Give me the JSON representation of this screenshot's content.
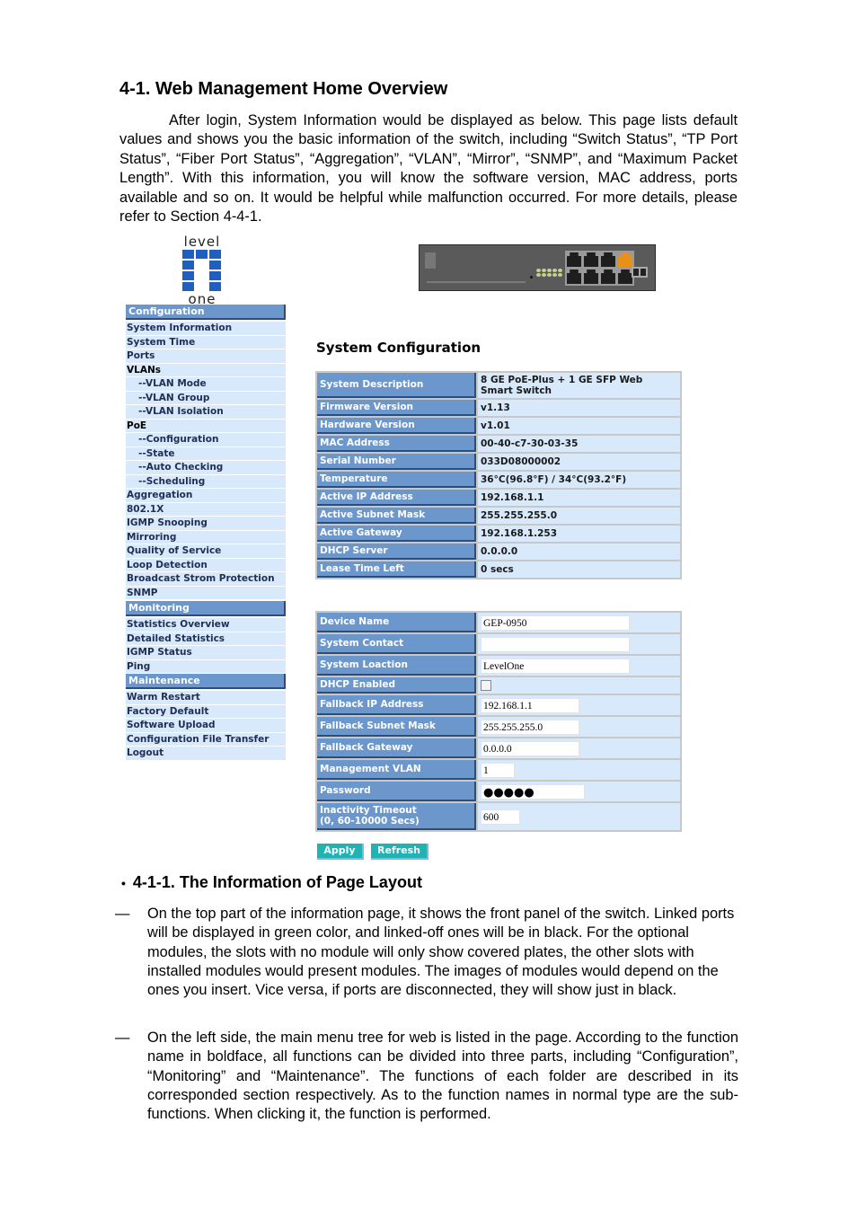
{
  "doc": {
    "section_title": "4-1. Web Management Home Overview",
    "intro": "After login, System Information would be displayed as below. This page lists default values and shows you the basic information of the switch, including “Switch Status”, “TP Port Status”, “Fiber Port Status”, “Aggregation”, “VLAN”, “Mirror”, “SNMP”, and “Maximum Packet Length”. With this information, you will know the software version, MAC address, ports available and so on. It would be helpful while malfunction occurred. For more details, please refer to Section 4-4-1.",
    "subsection_title": "4-1-1. The Information of Page Layout",
    "bullet_glyph": "•",
    "dash_glyph": "—",
    "bullets": [
      "On the top part of the information page, it shows the front panel of the switch. Linked ports will be displayed in green color, and linked-off ones will be in black. For the optional modules, the slots with no module will only show covered plates, the other slots with installed modules would present modules. The images of modules would depend on the ones you insert. Vice versa, if ports are disconnected, they will show just in black.",
      "On the left side, the main menu tree for web is listed in the page.  According to the function name in boldface, all functions can be divided into three parts, including “Configuration”, “Monitoring” and “Maintenance”. The functions of each folder are described in its corresponded section respectively. As to the function names in normal type are the sub-functions. When clicking it, the function is performed."
    ]
  },
  "logo": {
    "top": "level",
    "bottom": "one"
  },
  "switch_panel": {
    "linked_port_color": "#e8901a",
    "port_count": 8,
    "sfp_count": 1
  },
  "sidebar": {
    "sections": [
      {
        "header": "Configuration",
        "items": [
          {
            "label": "System Information",
            "type": "item"
          },
          {
            "label": "System Time",
            "type": "item"
          },
          {
            "label": "Ports",
            "type": "item"
          },
          {
            "label": "VLANs",
            "type": "folder"
          },
          {
            "label": "--VLAN Mode",
            "type": "sub"
          },
          {
            "label": "--VLAN Group",
            "type": "sub"
          },
          {
            "label": "--VLAN Isolation",
            "type": "sub"
          },
          {
            "label": "PoE",
            "type": "folder"
          },
          {
            "label": "--Configuration",
            "type": "sub"
          },
          {
            "label": "--State",
            "type": "sub"
          },
          {
            "label": "--Auto Checking",
            "type": "sub"
          },
          {
            "label": "--Scheduling",
            "type": "sub"
          },
          {
            "label": "Aggregation",
            "type": "item"
          },
          {
            "label": "802.1X",
            "type": "item"
          },
          {
            "label": "IGMP Snooping",
            "type": "item"
          },
          {
            "label": "Mirroring",
            "type": "item"
          },
          {
            "label": "Quality of Service",
            "type": "item"
          },
          {
            "label": "Loop Detection",
            "type": "item"
          },
          {
            "label": "Broadcast Strom Protection",
            "type": "item"
          },
          {
            "label": "SNMP",
            "type": "item"
          }
        ]
      },
      {
        "header": "Monitoring",
        "items": [
          {
            "label": "Statistics Overview",
            "type": "item"
          },
          {
            "label": "Detailed Statistics",
            "type": "item"
          },
          {
            "label": "IGMP Status",
            "type": "item"
          },
          {
            "label": "Ping",
            "type": "item"
          }
        ]
      },
      {
        "header": "Maintenance",
        "items": [
          {
            "label": "Warm Restart",
            "type": "item"
          },
          {
            "label": "Factory Default",
            "type": "item"
          },
          {
            "label": "Software Upload",
            "type": "item"
          },
          {
            "label": "Configuration File Transfer",
            "type": "item"
          },
          {
            "label": "Logout",
            "type": "item"
          }
        ]
      }
    ]
  },
  "main": {
    "title": "System Configuration",
    "info_rows": [
      {
        "label": "System Description",
        "value": "8 GE PoE-Plus + 1 GE SFP Web Smart Switch"
      },
      {
        "label": "Firmware Version",
        "value": "v1.13"
      },
      {
        "label": "Hardware Version",
        "value": "v1.01"
      },
      {
        "label": "MAC Address",
        "value": "00-40-c7-30-03-35"
      },
      {
        "label": "Serial Number",
        "value": "033D08000002"
      },
      {
        "label": "Temperature",
        "value": "36°C(96.8°F) / 34°C(93.2°F)"
      },
      {
        "label": "Active IP Address",
        "value": "192.168.1.1"
      },
      {
        "label": "Active Subnet Mask",
        "value": "255.255.255.0"
      },
      {
        "label": "Active Gateway",
        "value": "192.168.1.253"
      },
      {
        "label": "DHCP Server",
        "value": "0.0.0.0"
      },
      {
        "label": "Lease Time Left",
        "value": "0 secs"
      }
    ],
    "config_rows": {
      "device_name": {
        "label": "Device Name",
        "value": "GEP-0950"
      },
      "system_contact": {
        "label": "System Contact",
        "value": ""
      },
      "system_location": {
        "label": "System Loaction",
        "value": "LevelOne"
      },
      "dhcp_enabled": {
        "label": "DHCP Enabled",
        "checked": false
      },
      "fallback_ip": {
        "label": "Fallback IP Address",
        "value": "192.168.1.1"
      },
      "fallback_mask": {
        "label": "Fallback Subnet Mask",
        "value": "255.255.255.0"
      },
      "fallback_gateway": {
        "label": "Fallback Gateway",
        "value": "0.0.0.0"
      },
      "mgmt_vlan": {
        "label": "Management VLAN",
        "value": "1"
      },
      "password": {
        "label": "Password",
        "value": "●●●●●"
      },
      "inactivity_timeout": {
        "label_line1": "Inactivity Timeout",
        "label_line2": "(0, 60-10000 Secs)",
        "value": "600"
      }
    },
    "apply_label": "Apply",
    "refresh_label": "Refresh"
  }
}
